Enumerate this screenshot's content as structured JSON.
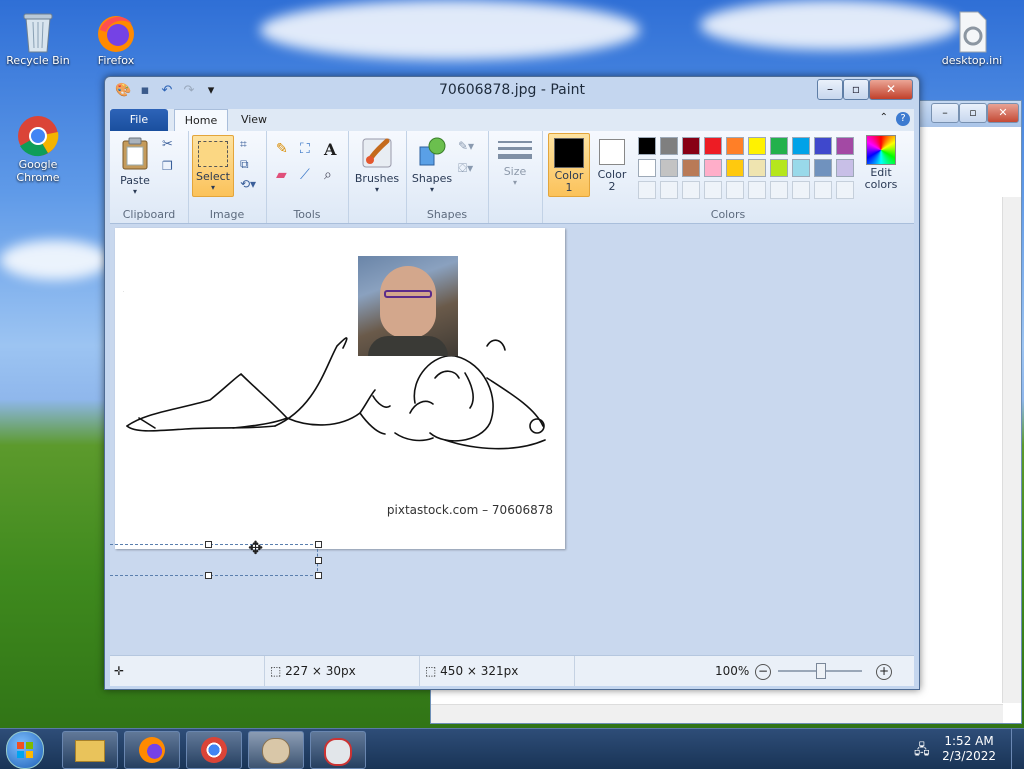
{
  "desktop": {
    "icons": [
      {
        "label": "Recycle Bin"
      },
      {
        "label": "Firefox"
      },
      {
        "label": "Google Chrome"
      },
      {
        "label": "desktop.ini"
      }
    ]
  },
  "paint": {
    "title": "70606878.jpg - Paint",
    "tabs": {
      "file": "File",
      "home": "Home",
      "view": "View"
    },
    "groups": {
      "clipboard": "Clipboard",
      "image": "Image",
      "tools": "Tools",
      "shapes": "Shapes",
      "colors": "Colors"
    },
    "buttons": {
      "paste": "Paste",
      "select": "Select",
      "brushes": "Brushes",
      "shapes": "Shapes",
      "size": "Size",
      "color1": "Color 1",
      "color2": "Color 2",
      "edit_colors": "Edit colors"
    },
    "color1": "#000000",
    "color2": "#ffffff",
    "palette_row1": [
      "#000000",
      "#7f7f7f",
      "#880015",
      "#ed1c24",
      "#ff7f27",
      "#fff200",
      "#22b14c",
      "#00a2e8",
      "#3f48cc",
      "#a349a4"
    ],
    "palette_row2": [
      "#ffffff",
      "#c3c3c3",
      "#b97a57",
      "#ffaec9",
      "#ffc90e",
      "#efe4b0",
      "#b5e61d",
      "#99d9ea",
      "#7092be",
      "#c8bfe7"
    ],
    "canvas": {
      "watermark": "pixtastock.com – 70606878"
    },
    "status": {
      "selection_size": "227 × 30px",
      "image_size": "450 × 321px",
      "zoom": "100%"
    }
  },
  "taskbar": {
    "time": "1:52 AM",
    "date": "2/3/2022"
  }
}
